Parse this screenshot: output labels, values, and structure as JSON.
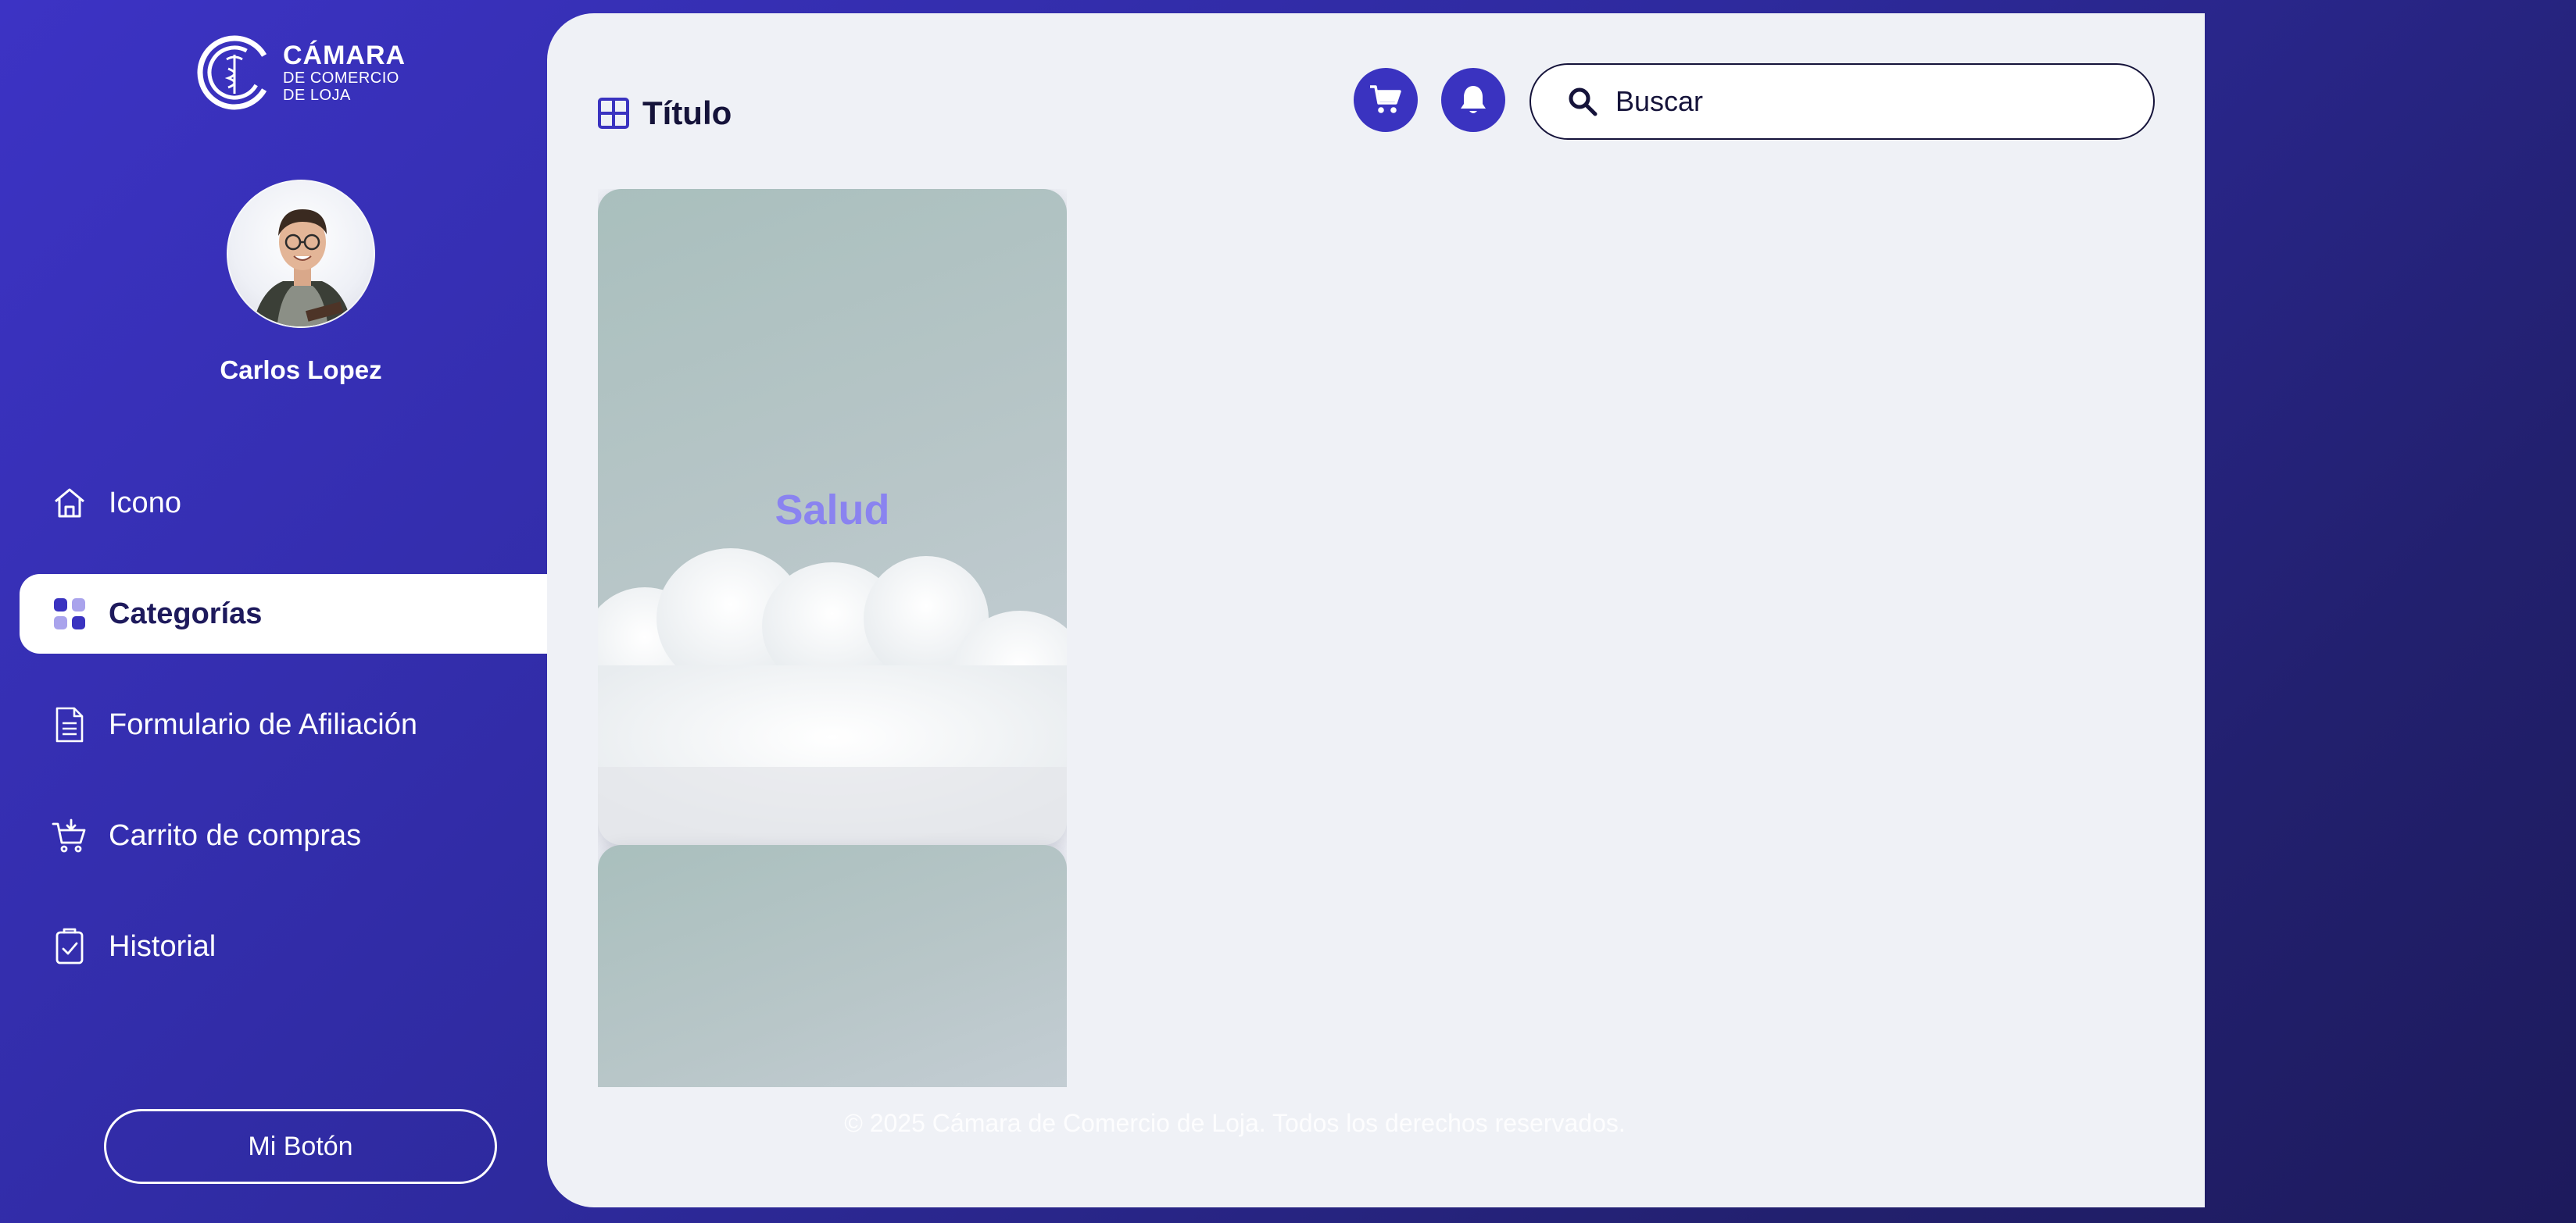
{
  "brand": {
    "line1": "CÁMARA",
    "line2": "DE COMERCIO",
    "line3": "DE LOJA"
  },
  "user": {
    "name": "Carlos Lopez"
  },
  "nav": {
    "items": [
      {
        "label": "Icono",
        "icon": "home-icon",
        "active": false
      },
      {
        "label": "Categorías",
        "icon": "categories-icon",
        "active": true
      },
      {
        "label": "Formulario de Afiliación",
        "icon": "form-document-icon",
        "active": false
      },
      {
        "label": "Carrito de compras",
        "icon": "shopping-cart-icon",
        "active": false
      },
      {
        "label": "Historial",
        "icon": "history-clipboard-icon",
        "active": false
      }
    ]
  },
  "sidebar": {
    "button_label": "Mi Botón"
  },
  "header": {
    "title": "Título",
    "search_placeholder": "Buscar"
  },
  "cards": [
    {
      "label": "Salud"
    },
    {
      "label": ""
    }
  ],
  "footer": {
    "text": "© 2025 Cámara de Comercio de Loja. Todos los derechos reservados."
  },
  "colors": {
    "accent": "#3a33c0",
    "sidebar_gradient_start": "#3c33c4",
    "sidebar_gradient_end": "#1d1a5c",
    "panel_bg": "#eff1f6",
    "card_label": "#8a83f0"
  }
}
